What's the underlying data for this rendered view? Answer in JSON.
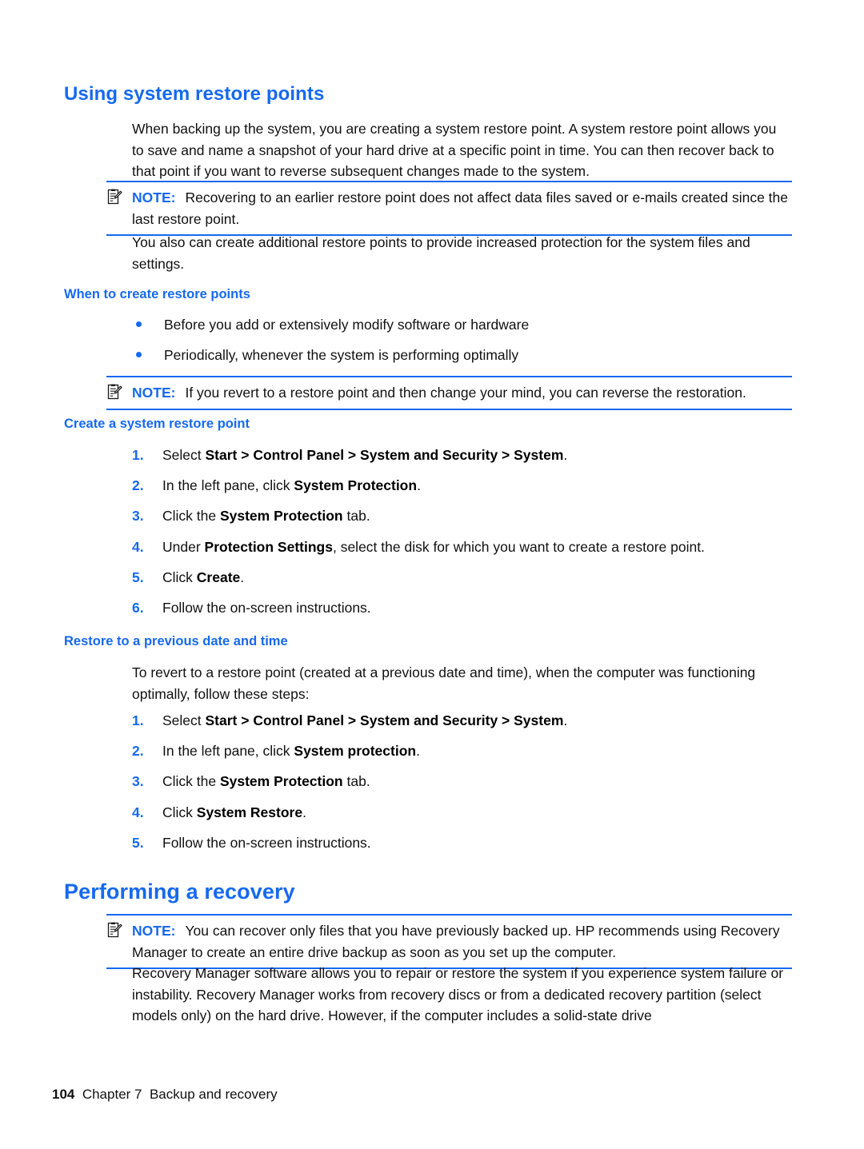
{
  "document": {
    "title": "Backup and recovery",
    "accent_color": "#1669ef",
    "text_color": "#111111",
    "background_color": "#ffffff"
  },
  "sections": {
    "heading_1": "Using system restore points",
    "intro_paragraph": "When backing up the system, you are creating a system restore point. A system restore point allows you to save and name a snapshot of your hard drive at a specific point in time. You can then recover back to that point if you want to reverse subsequent changes made to the system.",
    "note_1": {
      "icon": "note-clipboard-icon",
      "label": "NOTE:",
      "text": "Recovering to an earlier restore point does not affect data files saved or e-mails created since the last restore point."
    },
    "paragraph_2": "You also can create additional restore points to provide increased protection for the system files and settings.",
    "heading_when_to_create": "When to create restore points",
    "bullets": [
      "Before you add or extensively modify software or hardware",
      "Periodically, whenever the system is performing optimally"
    ],
    "note_2": {
      "icon": "note-clipboard-icon",
      "label": "NOTE:",
      "text": "If you revert to a restore point and then change your mind, you can reverse the restoration."
    },
    "heading_create_restore_point": "Create a system restore point",
    "create_steps": [
      {
        "num": "1.",
        "parts": [
          {
            "t": "Select ",
            "bold": false
          },
          {
            "t": "Start > Control Panel > System and Security > System",
            "bold": true
          },
          {
            "t": ".",
            "bold": false
          }
        ]
      },
      {
        "num": "2.",
        "parts": [
          {
            "t": "In the left pane, click ",
            "bold": false
          },
          {
            "t": "System Protection",
            "bold": true
          },
          {
            "t": ".",
            "bold": false
          }
        ]
      },
      {
        "num": "3.",
        "parts": [
          {
            "t": "Click the ",
            "bold": false
          },
          {
            "t": "System Protection",
            "bold": true
          },
          {
            "t": " tab.",
            "bold": false
          }
        ]
      },
      {
        "num": "4.",
        "parts": [
          {
            "t": "Under ",
            "bold": false
          },
          {
            "t": "Protection Settings",
            "bold": true
          },
          {
            "t": ", select the disk for which you want to create a restore point.",
            "bold": false
          }
        ]
      },
      {
        "num": "5.",
        "parts": [
          {
            "t": "Click ",
            "bold": false
          },
          {
            "t": "Create",
            "bold": true
          },
          {
            "t": ".",
            "bold": false
          }
        ]
      },
      {
        "num": "6.",
        "parts": [
          {
            "t": "Follow the on-screen instructions.",
            "bold": false
          }
        ]
      }
    ],
    "heading_restore_previous": "Restore to a previous date and time",
    "restore_intro": "To revert to a restore point (created at a previous date and time), when the computer was functioning optimally, follow these steps:",
    "restore_steps": [
      {
        "num": "1.",
        "parts": [
          {
            "t": "Select ",
            "bold": false
          },
          {
            "t": "Start > Control Panel > System and Security > System",
            "bold": true
          },
          {
            "t": ".",
            "bold": false
          }
        ]
      },
      {
        "num": "2.",
        "parts": [
          {
            "t": "In the left pane, click ",
            "bold": false
          },
          {
            "t": "System protection",
            "bold": true
          },
          {
            "t": ".",
            "bold": false
          }
        ]
      },
      {
        "num": "3.",
        "parts": [
          {
            "t": "Click the ",
            "bold": false
          },
          {
            "t": "System Protection",
            "bold": true
          },
          {
            "t": " tab.",
            "bold": false
          }
        ]
      },
      {
        "num": "4.",
        "parts": [
          {
            "t": "Click ",
            "bold": false
          },
          {
            "t": "System Restore",
            "bold": true
          },
          {
            "t": ".",
            "bold": false
          }
        ]
      },
      {
        "num": "5.",
        "parts": [
          {
            "t": "Follow the on-screen instructions.",
            "bold": false
          }
        ]
      }
    ],
    "heading_2": "Performing a recovery",
    "note_3": {
      "icon": "note-clipboard-icon",
      "label": "NOTE:",
      "text": "You can recover only files that you have previously backed up. HP recommends using Recovery Manager to create an entire drive backup as soon as you set up the computer."
    },
    "closing_paragraph": "Recovery Manager software allows you to repair or restore the system if you experience system failure or instability. Recovery Manager works from recovery discs or from a dedicated recovery partition (select models only) on the hard drive. However, if the computer includes a solid-state drive"
  },
  "footer": {
    "page_number": "104",
    "chapter": "Chapter 7",
    "chapter_title": "Backup and recovery"
  }
}
